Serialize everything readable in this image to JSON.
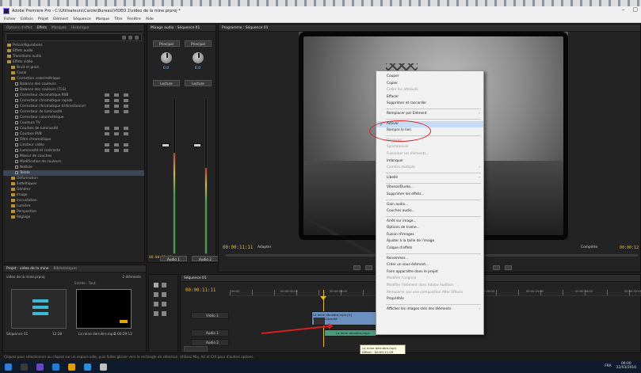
{
  "window": {
    "title": "Adobe Premiere Pro - C:\\Utilisateurs\\Carole\\Bureau\\VIDEO 2\\video de la mine.prproj *",
    "controls": [
      "–",
      "▢",
      "✕"
    ]
  },
  "menu": [
    "Fichier",
    "Edition",
    "Projet",
    "Elément",
    "Séquence",
    "Marque",
    "Titre",
    "Fenêtre",
    "Aide"
  ],
  "effects_panel": {
    "tabs": [
      "Options d'effet",
      "Effets",
      "Marques",
      "Historique"
    ],
    "tree": [
      {
        "label": "Préconfigurations",
        "type": "folder",
        "indent": 1
      },
      {
        "label": "Effets audio",
        "type": "folder",
        "indent": 1
      },
      {
        "label": "Transitions audio",
        "type": "folder",
        "indent": 1
      },
      {
        "label": "Effets vidéo",
        "type": "folder",
        "indent": 1
      },
      {
        "label": "Bruit et grain",
        "type": "folder",
        "indent": 2
      },
      {
        "label": "Canal",
        "type": "folder",
        "indent": 2
      },
      {
        "label": "Correction colorimétrique",
        "type": "folder",
        "indent": 2
      },
      {
        "label": "Balance des couleurs",
        "type": "fx",
        "indent": 3
      },
      {
        "label": "Balance des couleurs (TLS)",
        "type": "fx",
        "indent": 3
      },
      {
        "label": "Correcteur chromatique RVB",
        "type": "fx",
        "indent": 3,
        "badges": true
      },
      {
        "label": "Correcteur chromatique rapide",
        "type": "fx",
        "indent": 3,
        "badges": true
      },
      {
        "label": "Correcteur chromatique tridirectionnel",
        "type": "fx",
        "indent": 3,
        "badges": true
      },
      {
        "label": "Correcteur de luminosité",
        "type": "fx",
        "indent": 3,
        "badges": true
      },
      {
        "label": "Correcteur colorimétrique",
        "type": "fx",
        "indent": 3
      },
      {
        "label": "Couleurs TV",
        "type": "fx",
        "indent": 3
      },
      {
        "label": "Courbes de luminosité",
        "type": "fx",
        "indent": 3,
        "badges": true
      },
      {
        "label": "Courbes RVB",
        "type": "fx",
        "indent": 3,
        "badges": true
      },
      {
        "label": "Filtre chromatique",
        "type": "fx",
        "indent": 3
      },
      {
        "label": "Limiteur vidéo",
        "type": "fx",
        "indent": 3,
        "badges": true
      },
      {
        "label": "Luminosité et contraste",
        "type": "fx",
        "indent": 3,
        "badges": true
      },
      {
        "label": "Mixeur de couches",
        "type": "fx",
        "indent": 3
      },
      {
        "label": "Modification de couleurs",
        "type": "fx",
        "indent": 3
      },
      {
        "label": "Nettoie",
        "type": "fx",
        "indent": 3
      },
      {
        "label": "Teinte",
        "type": "fx",
        "indent": 3,
        "highlight": true
      },
      {
        "label": "Déformation",
        "type": "folder",
        "indent": 2
      },
      {
        "label": "Esthétiques",
        "type": "folder",
        "indent": 2
      },
      {
        "label": "Générer",
        "type": "folder",
        "indent": 2
      },
      {
        "label": "Image",
        "type": "folder",
        "indent": 2
      },
      {
        "label": "Incrustation",
        "type": "folder",
        "indent": 2
      },
      {
        "label": "Lumière",
        "type": "folder",
        "indent": 2
      },
      {
        "label": "Perspective",
        "type": "folder",
        "indent": 2
      },
      {
        "label": "Réglage",
        "type": "folder",
        "indent": 2
      }
    ]
  },
  "audio_mixer": {
    "tabs": [
      "Mixage audio : Séquence 01"
    ],
    "channels": [
      {
        "label": "Principal",
        "value": "0.0",
        "name": "Audio 1",
        "level": 0.65
      },
      {
        "label": "Principal",
        "value": "0.0",
        "name": "Audio 2",
        "level": 0.55
      }
    ],
    "mode": "Lecture",
    "timecode": "00:00:11:11"
  },
  "program_monitor": {
    "tabs": [
      "Programme : Séquence 01"
    ],
    "timecode": "00:00:11:11",
    "fit": "Adapter",
    "zoom": "Complète",
    "duration": "00:00:12"
  },
  "project_panel": {
    "tabs": [
      "Projet : video de la mine",
      "Bibliothèques"
    ],
    "file": "video de la mine.prproj",
    "count": "2 éléments",
    "search_label": "Entrée : Tout",
    "items": [
      {
        "name": "Séquence 01",
        "duration": "12:28"
      },
      {
        "name": "La mine dernière.mp4",
        "duration": "1:00:29:12"
      }
    ]
  },
  "timeline": {
    "tab": "Séquence 01",
    "timecode": "00:00:11:11",
    "tracks": [
      {
        "name": "Vidéo 1",
        "id": "V1"
      },
      {
        "name": "Audio 1",
        "id": "A1"
      },
      {
        "name": "Audio 2",
        "id": "A2"
      }
    ],
    "clip_video": "La mine dernière.mp4 [V] Opacité:Opacité",
    "clip_audio": "La mine dernière.mp4",
    "ruler": [
      "00:00",
      "00:00:04:00",
      "00:00:08:00",
      "00:00:12:00",
      "00:00:16:00",
      "00:00:20:00",
      "00:00:24:00",
      "00:00:28:00",
      "00:00:32:00"
    ]
  },
  "context_menu": {
    "items": [
      {
        "label": "Couper",
        "state": "normal"
      },
      {
        "label": "Copier",
        "state": "normal"
      },
      {
        "label": "Coller les attributs",
        "state": "disabled"
      },
      {
        "label": "Effacer",
        "state": "normal"
      },
      {
        "label": "Supprimer et raccorder",
        "state": "normal"
      },
      {
        "sep": true
      },
      {
        "label": "Remplacer par Elément",
        "state": "normal",
        "arrow": true
      },
      {
        "sep": true
      },
      {
        "label": "Activer",
        "state": "normal",
        "check": true,
        "highlight": true
      },
      {
        "label": "Rompre le lien",
        "state": "normal"
      },
      {
        "sep": true
      },
      {
        "label": "Dissocier",
        "state": "disabled"
      },
      {
        "label": "Synchroniser",
        "state": "disabled"
      },
      {
        "label": "Fusionner les éléments...",
        "state": "disabled"
      },
      {
        "label": "Imbriquer",
        "state": "normal"
      },
      {
        "label": "Caméra multiple",
        "state": "disabled",
        "arrow": true
      },
      {
        "sep": true
      },
      {
        "label": "Libellé",
        "state": "normal",
        "arrow": true
      },
      {
        "sep": true
      },
      {
        "label": "Vitesse/Durée...",
        "state": "normal"
      },
      {
        "label": "Supprimer les effets...",
        "state": "normal"
      },
      {
        "sep": true
      },
      {
        "label": "Gain audio...",
        "state": "normal"
      },
      {
        "label": "Couches audio...",
        "state": "normal"
      },
      {
        "sep": true
      },
      {
        "label": "Arrêt sur image...",
        "state": "normal"
      },
      {
        "label": "Options de trame...",
        "state": "normal"
      },
      {
        "label": "Fusion d'images",
        "state": "normal"
      },
      {
        "label": "Ajuster à la taille de l'image",
        "state": "normal"
      },
      {
        "label": "Calque d'effets",
        "state": "normal"
      },
      {
        "sep": true
      },
      {
        "label": "Renommer...",
        "state": "normal"
      },
      {
        "label": "Créer un sous-élément...",
        "state": "normal"
      },
      {
        "label": "Faire apparaître dans le projet",
        "state": "normal"
      },
      {
        "label": "Modifier l'original",
        "state": "disabled"
      },
      {
        "label": "Modifier l'élément dans Adobe Audition",
        "state": "disabled"
      },
      {
        "label": "Remplacer par une composition After Effects",
        "state": "disabled"
      },
      {
        "label": "Propriétés",
        "state": "normal"
      },
      {
        "sep": true
      },
      {
        "label": "Afficher les images-clés des éléments",
        "state": "normal",
        "arrow": true
      }
    ]
  },
  "tooltip": {
    "lines": [
      "La mine dernière.mp4",
      "Début : 00:00:11:09",
      "Fin : 00:00:12:23",
      "Durée : 00:00:01:15"
    ]
  },
  "status": "Cliquez pour sélectionner ou cliquez sur un espace vide, puis faites glisser vers le rectangle de sélection. Utilisez Maj, Alt et Ctrl pour d'autres options.",
  "taskbar": {
    "clock": "09:00",
    "date": "22/03/2016",
    "lang": "FRA"
  },
  "colors": {
    "accent_timecode": "#e8b83a",
    "highlight_row": "#3b4758",
    "annotation": "#d61f1f",
    "clip_video": "#6b8fbe",
    "clip_audio": "#4a9a7c"
  }
}
